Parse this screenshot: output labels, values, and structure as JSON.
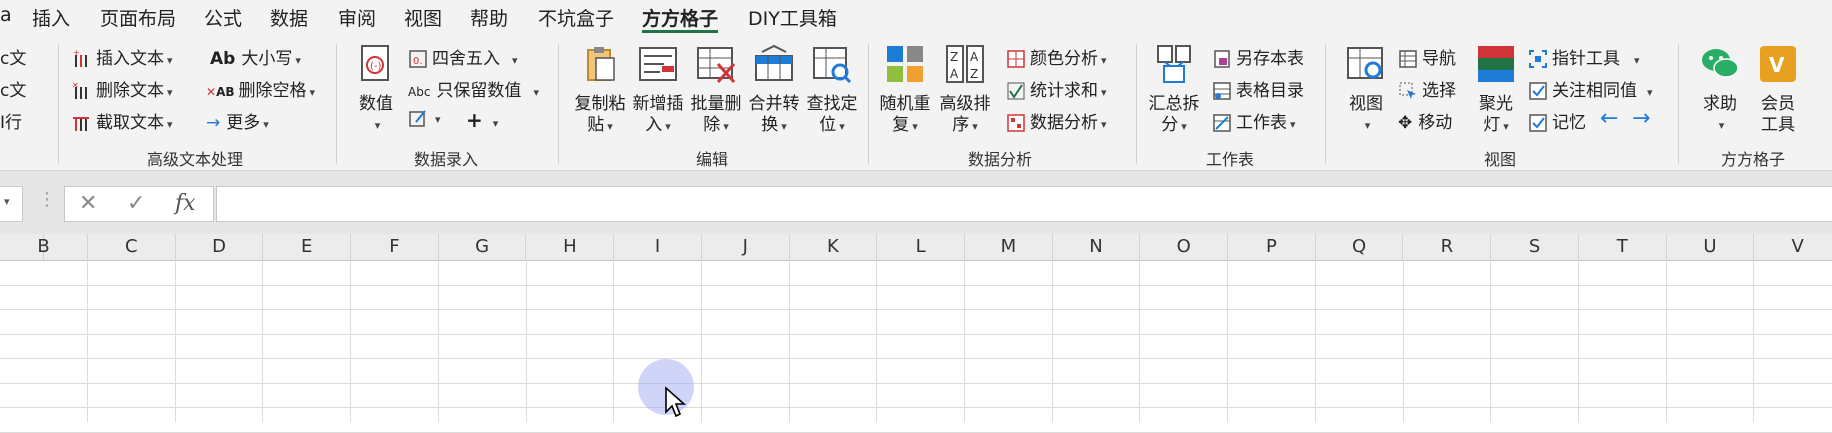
{
  "tabs": [
    {
      "label": "插入"
    },
    {
      "label": "页面布局"
    },
    {
      "label": "公式"
    },
    {
      "label": "数据"
    },
    {
      "label": "审阅"
    },
    {
      "label": "视图"
    },
    {
      "label": "帮助"
    },
    {
      "label": "不坑盒子"
    },
    {
      "label": "方方格子",
      "active": true
    },
    {
      "label": "DIY工具箱"
    }
  ],
  "tab_fragment": "a",
  "left_partial": [
    "c文",
    "c文",
    "I行"
  ],
  "advanced_text": {
    "items": [
      "插入文本",
      "删除文本",
      "截取文本"
    ],
    "case_label": "大小写",
    "del_space": "删除空格",
    "more": "更多",
    "group_label": "高级文本处理"
  },
  "data_entry": {
    "value_label": "数值",
    "round_label": "四舍五入",
    "keep_value": "只保留数值",
    "plus": "+",
    "group_label": "数据录入"
  },
  "edit": {
    "buttons": [
      {
        "line1": "复制粘",
        "line2": "贴"
      },
      {
        "line1": "新增插",
        "line2": "入"
      },
      {
        "line1": "批量删",
        "line2": "除"
      },
      {
        "line1": "合并转",
        "line2": "换"
      },
      {
        "line1": "查找定",
        "line2": "位"
      }
    ],
    "group_label": "编辑"
  },
  "analysis": {
    "buttons": [
      {
        "line1": "随机重",
        "line2": "复"
      },
      {
        "line1": "高级排",
        "line2": "序"
      }
    ],
    "items": [
      "颜色分析",
      "统计求和",
      "数据分析"
    ],
    "group_label": "数据分析"
  },
  "worksheet": {
    "split_line1": "汇总拆",
    "split_line2": "分",
    "items": [
      "另存本表",
      "表格目录",
      "工作表"
    ],
    "group_label": "工作表"
  },
  "view": {
    "view_label": "视图",
    "nav": "导航",
    "select": "选择",
    "move": "移动",
    "spot_line1": "聚光",
    "spot_line2": "灯",
    "items": [
      "指针工具",
      "关注相同值",
      "记忆"
    ],
    "group_label": "视图"
  },
  "fangfang": {
    "help": "求助",
    "member_line1": "会员",
    "member_line2": "工具",
    "group_label": "方方格子"
  },
  "formula_bar": {
    "cancel": "✕",
    "confirm": "✓",
    "fx": "fx",
    "value": ""
  },
  "columns": [
    "B",
    "C",
    "D",
    "E",
    "F",
    "G",
    "H",
    "I",
    "J",
    "K",
    "L",
    "M",
    "N",
    "O",
    "P",
    "Q",
    "R",
    "S",
    "T",
    "U",
    "V"
  ],
  "colors": {
    "accent": "#217346",
    "blue": "#1e7bd6",
    "red": "#d13438"
  }
}
